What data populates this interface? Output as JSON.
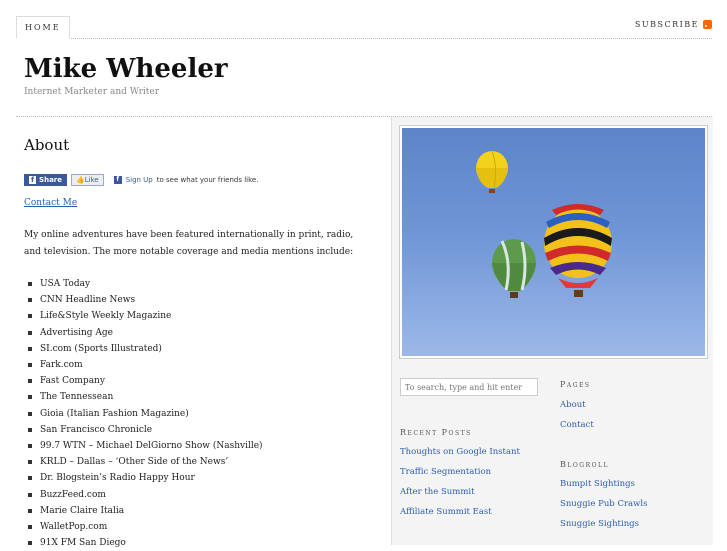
{
  "nav": {
    "home": "HOME",
    "subscribe": "SUBSCRIBE"
  },
  "site": {
    "title": "Mike Wheeler",
    "description": "Internet Marketer and Writer"
  },
  "page": {
    "title": "About",
    "social": {
      "share": "Share",
      "like": "Like",
      "signup": "Sign Up",
      "signup_rest": "to see what your friends like."
    },
    "contact_link": "Contact Me",
    "intro": "My online adventures have been featured internationally in print, radio, and television. The more notable coverage and media mentions include:",
    "media": [
      "USA Today",
      "CNN Headline News",
      "Life&Style Weekly Magazine",
      "Advertising Age",
      "SI.com (Sports Illustrated)",
      "Fark.com",
      "Fast Company",
      "The Tennessean",
      "Gioia (Italian Fashion Magazine)",
      "San Francisco Chronicle",
      "99.7 WTN – Michael DelGiorno Show (Nashville)",
      "KRLD – Dallas – ‘Other Side of the News’",
      "Dr. Blogstein’s Radio Happy Hour",
      "BuzzFeed.com",
      "Marie Claire Italia",
      "WalletPop.com",
      "91X FM San Diego"
    ]
  },
  "sidebar": {
    "search_placeholder": "To search, type and hit enter",
    "recent_posts": {
      "title": "Recent Posts",
      "items": [
        "Thoughts on Google Instant",
        "Traffic Segmentation",
        "After the Summit",
        "Affiliate Summit East"
      ]
    },
    "pages": {
      "title": "Pages",
      "items": [
        "About",
        "Contact"
      ]
    },
    "blogroll": {
      "title": "Blogroll",
      "items": [
        "Bumpit Sightings",
        "Snuggie Pub Crawls",
        "Snuggie Sightings"
      ]
    }
  },
  "colors": {
    "link": "#2a5db0",
    "facebook": "#3b5998",
    "rss": "#ff6600"
  }
}
